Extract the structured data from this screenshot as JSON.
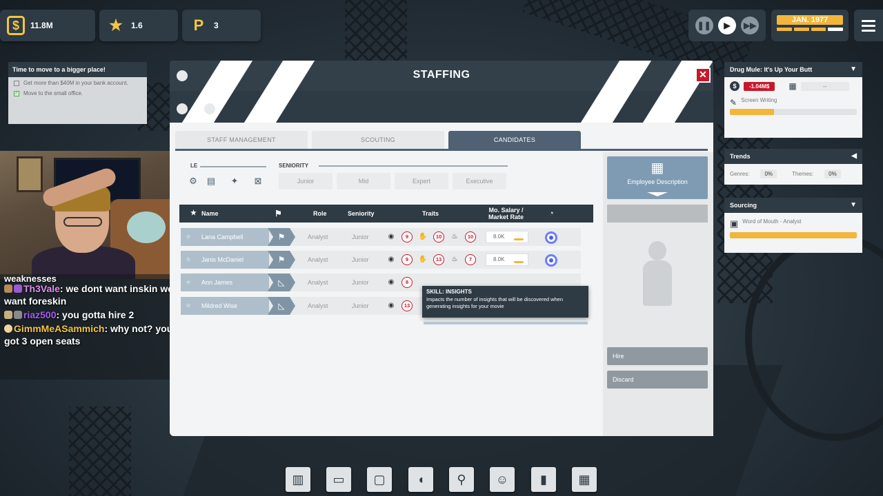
{
  "hud": {
    "money": "11.8M",
    "stars": "1.6",
    "parking": "3",
    "date": "JAN. 1977"
  },
  "goal": {
    "title": "Time to move to a bigger place!",
    "items": [
      {
        "text": "Get more than $40M in your bank account.",
        "done": false
      },
      {
        "text": "Move to the small office.",
        "done": true
      }
    ]
  },
  "chat": {
    "fragment": "weaknesses",
    "messages": [
      {
        "user": "Th3Vale",
        "text": ": we dont want inskin we want foreskin"
      },
      {
        "user": "riaz500",
        "text": ": you gotta hire 2"
      },
      {
        "user": "GimmMeASammich",
        "text": ": why not? you got 3 open seats"
      }
    ]
  },
  "project": {
    "title": "Drug Mule: It's Up Your Butt",
    "budget": "-1.04M$",
    "date_value": "--",
    "task": "Screen Writing",
    "progress": 0.35
  },
  "trends": {
    "title": "Trends",
    "genres_label": "Genres:",
    "genres_value": "0%",
    "themes_label": "Themes:",
    "themes_value": "0%"
  },
  "sourcing": {
    "title": "Sourcing",
    "item": "Word of Mouth - Analyst",
    "progress": 1.0
  },
  "modal": {
    "title": "STAFFING",
    "tabs": [
      "STAFF MANAGEMENT",
      "SCOUTING",
      "CANDIDATES"
    ],
    "role_filter_label": "LE",
    "seniority_label": "SENIORITY",
    "seniority_options": [
      "Junior",
      "Mid",
      "Expert",
      "Executive"
    ],
    "columns": {
      "name": "Name",
      "role": "Role",
      "seniority": "Seniority",
      "traits": "Traits",
      "salary": "Mo. Salary /",
      "salary2": "Market Rate"
    },
    "rows": [
      {
        "name": "Lana Campbell",
        "role": "Analyst",
        "seniority": "Junior",
        "traits": [
          "9",
          "10",
          "10"
        ],
        "salary": "8.0K"
      },
      {
        "name": "Janis McDaniel",
        "role": "Analyst",
        "seniority": "Junior",
        "traits": [
          "9",
          "13",
          "7"
        ],
        "salary": "8.0K"
      },
      {
        "name": "Ann James",
        "role": "Analyst",
        "seniority": "Junior",
        "traits": [
          "8"
        ],
        "salary": ""
      },
      {
        "name": "Mildred Wise",
        "role": "Analyst",
        "seniority": "Junior",
        "traits": [
          "13"
        ],
        "salary": ""
      }
    ],
    "tooltip": {
      "title": "SKILL: INSIGHTS",
      "text": "Impacts the number of insights that will be discovered when generating insights for your movie"
    },
    "side": {
      "description_label": "Employee Description",
      "hire_label": "Hire",
      "discard_label": "Discard"
    }
  },
  "colors": {
    "panel_dark": "#2e3a44",
    "accent_gold": "#f2b63b",
    "danger_red": "#c8172a",
    "active_tab": "#4f6172"
  }
}
